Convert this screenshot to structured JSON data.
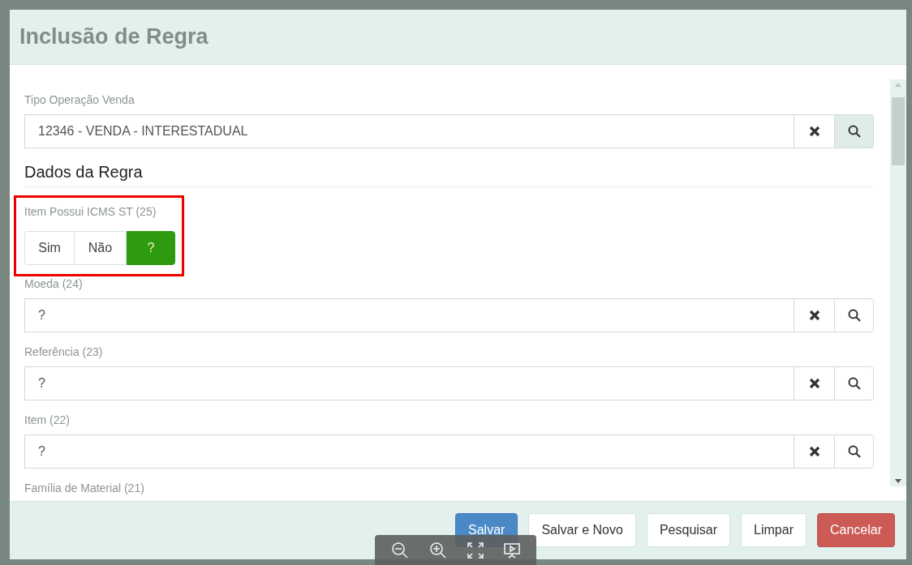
{
  "dialog": {
    "title": "Inclusão de Regra"
  },
  "fields": [
    {
      "kind": "lookup",
      "label": "Tipo Operação Venda",
      "value": "12346 - VENDA - INTERESTADUAL",
      "search_highlighted": true
    },
    {
      "kind": "heading",
      "text": "Dados da Regra"
    },
    {
      "kind": "toggle",
      "label": "Item Possui ICMS ST (25)",
      "highlighted": true,
      "options": [
        {
          "label": "Sim",
          "selected": false
        },
        {
          "label": "Não",
          "selected": false
        },
        {
          "label": "?",
          "selected": true
        }
      ]
    },
    {
      "kind": "lookup",
      "label": "Moeda (24)",
      "value": "?",
      "search_highlighted": false
    },
    {
      "kind": "lookup",
      "label": "Referência (23)",
      "value": "?",
      "search_highlighted": false
    },
    {
      "kind": "lookup",
      "label": "Item (22)",
      "value": "?",
      "search_highlighted": false
    },
    {
      "kind": "label",
      "label": "Família de Material (21)"
    }
  ],
  "buttons": [
    {
      "label": "Salvar",
      "kind": "primary"
    },
    {
      "label": "Salvar e Novo",
      "kind": "default"
    },
    {
      "label": "Pesquisar",
      "kind": "default"
    },
    {
      "label": "Limpar",
      "kind": "default"
    },
    {
      "label": "Cancelar",
      "kind": "danger"
    }
  ]
}
